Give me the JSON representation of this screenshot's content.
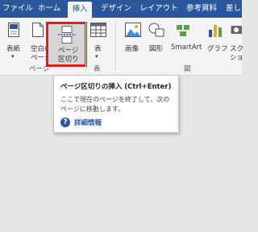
{
  "tabs": [
    "ファイル",
    "ホーム",
    "挿入",
    "デザイン",
    "レイアウト",
    "参考資料",
    "差し"
  ],
  "ribbon": {
    "cover_page": "表紙",
    "blank_page_1": "空白の",
    "blank_page_2": "ページ",
    "page_break_1": "ページ",
    "page_break_2": "区切り",
    "table": "表",
    "image": "画像",
    "shapes": "図形",
    "smartart": "SmartArt",
    "graph": "グラフ",
    "screenshot_1": "スク",
    "screenshot_2": "ショ",
    "group_pages": "ページ",
    "group_table": "表",
    "group_illustrations": "図"
  },
  "tooltip": {
    "title": "ページ区切りの挿入 (Ctrl+Enter)",
    "description": "ここで現在のページを終了して、次のページに移動します。",
    "help_label": "詳細情報"
  },
  "colors": {
    "tab_bar": "#2b579a",
    "ribbon_bg": "#f3f3f3",
    "highlight": "#e21b1b",
    "content_bg": "#e6e6e6"
  }
}
